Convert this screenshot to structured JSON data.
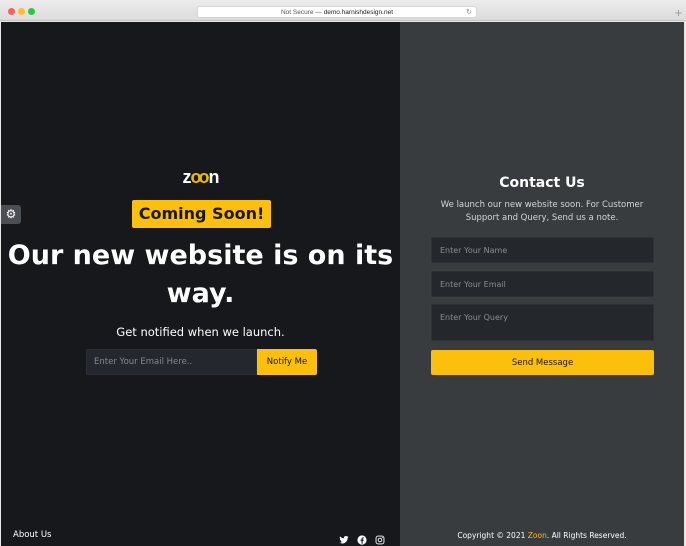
{
  "browser": {
    "url_prefix": "Not Secure — ",
    "url_host": "demo.harnishdesign.net",
    "new_tab": "+"
  },
  "left": {
    "logo": {
      "before": "z",
      "oo": "oo",
      "after": "n"
    },
    "badge": "Coming Soon!",
    "headline": "Our new website is on its way.",
    "subtitle": "Get notified when we launch.",
    "email_placeholder": "Enter Your Email Here..",
    "notify_label": "Notify Me",
    "about_label": "About Us"
  },
  "right": {
    "title": "Contact Us",
    "description": "We launch our new website soon. For Customer Support and Query, Send us a note.",
    "name_placeholder": "Enter Your Name",
    "email_placeholder": "Enter Your Email",
    "query_placeholder": "Enter Your Query",
    "send_label": "Send Message",
    "copyright_before": "Copyright © 2021 ",
    "copyright_brand": "Zoon",
    "copyright_after": ". All Rights Reserved."
  },
  "icons": {
    "settings": "gear-icon",
    "socials": [
      "twitter-icon",
      "facebook-icon",
      "instagram-icon"
    ],
    "reload": "reload-icon"
  },
  "colors": {
    "accent": "#fbbf0c",
    "left_bg": "#17181c",
    "right_bg": "#383c3f"
  }
}
